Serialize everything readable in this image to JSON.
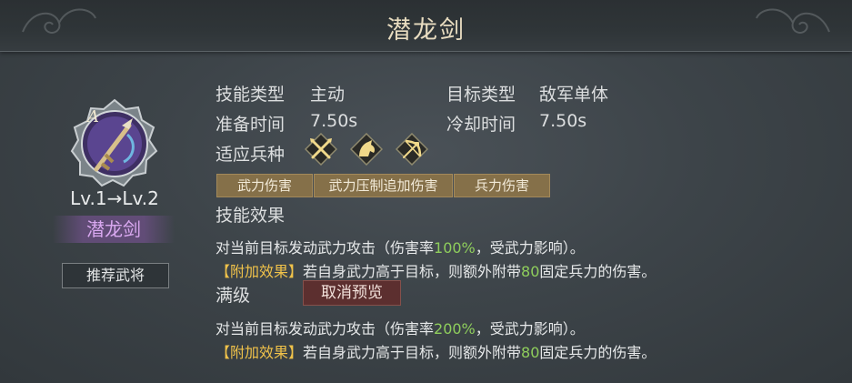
{
  "header": {
    "title": "潜龙剑"
  },
  "skill": {
    "grade": "A",
    "level_text": "Lv.1→Lv.2",
    "name": "潜龙剑",
    "recommend_label": "推荐武将"
  },
  "info": {
    "skill_type_label": "技能类型",
    "skill_type_value": "主动",
    "target_type_label": "目标类型",
    "target_type_value": "敌军单体",
    "prep_time_label": "准备时间",
    "prep_time_value": "7.50s",
    "cooldown_label": "冷却时间",
    "cooldown_value": "7.50s",
    "unit_types_label": "适应兵种",
    "unit_types": [
      "spear-icon",
      "cavalry-icon",
      "archer-icon"
    ]
  },
  "tags": [
    "武力伤害",
    "武力压制追加伤害",
    "兵力伤害"
  ],
  "effect": {
    "label": "技能效果",
    "line1_pre": "对当前目标发动武力攻击（伤害率",
    "line1_rate": "100%",
    "line1_post": "，受武力影响）。",
    "line2_tag": "【附加效果】",
    "line2_pre": "若自身武力高于目标，则额外附带",
    "line2_value": "80",
    "line2_post": "固定兵力的伤害。"
  },
  "max_level": {
    "label": "满级",
    "cancel_preview_label": "取消预览",
    "line1_pre": "对当前目标发动武力攻击（伤害率",
    "line1_rate": "200%",
    "line1_post": "，受武力影响）。",
    "line2_tag": "【附加效果】",
    "line2_pre": "若自身武力高于目标，则额外附带",
    "line2_value": "80",
    "line2_post": "固定兵力的伤害。"
  },
  "colors": {
    "highlight_green": "#8fce5c",
    "highlight_gold": "#f0c24a",
    "skill_name_purple": "#d9a8f0",
    "tag_bg": "#857049",
    "cancel_bg": "#5c2f2f"
  }
}
